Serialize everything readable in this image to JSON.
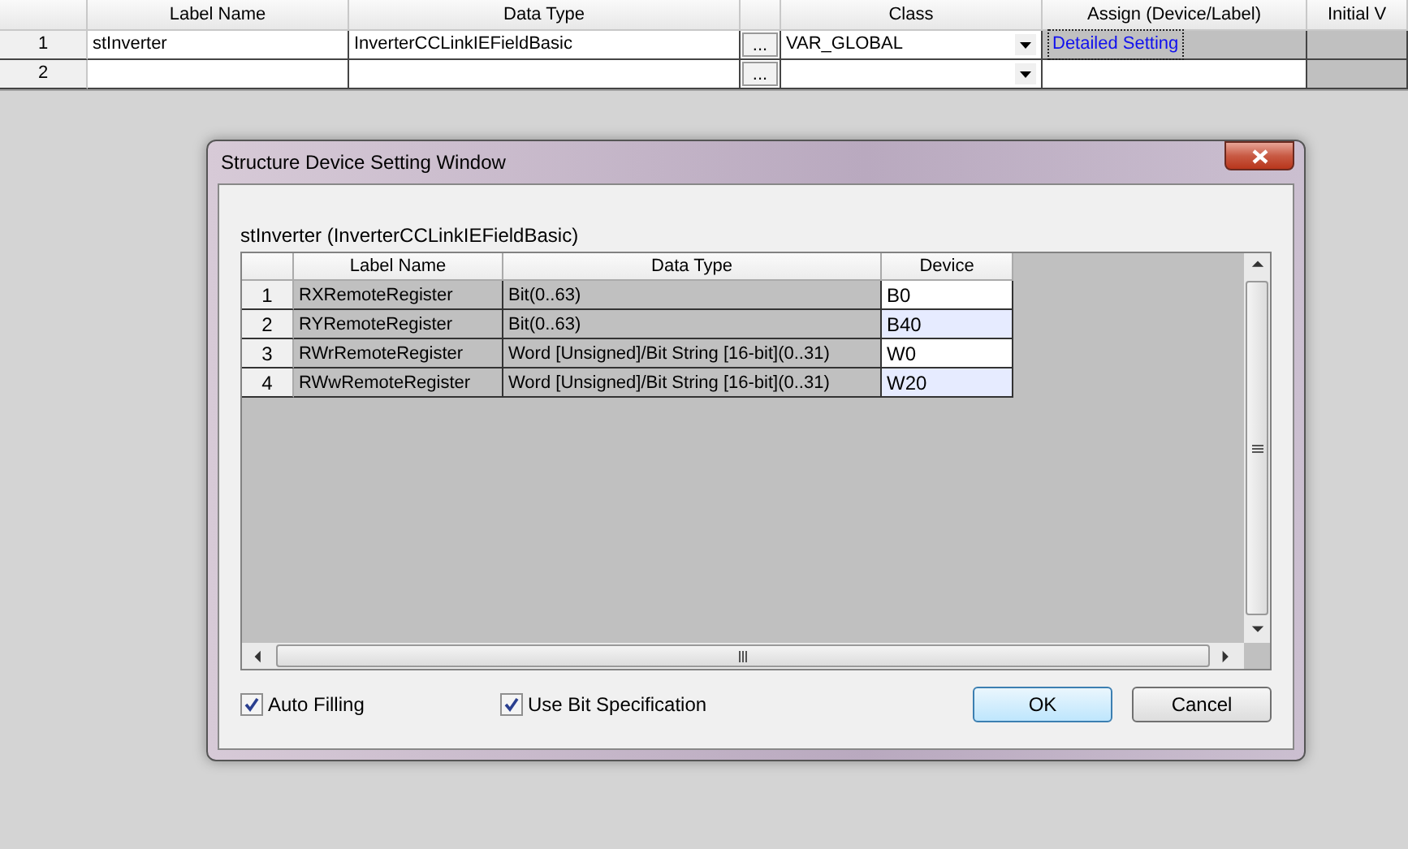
{
  "grid": {
    "columns": [
      "Label Name",
      "Data Type",
      "Class",
      "Assign (Device/Label)",
      "Initial V"
    ],
    "rows": [
      {
        "number": "1",
        "label_name": "stInverter",
        "data_type": "InverterCCLinkIEFieldBasic",
        "browse": "...",
        "class": "VAR_GLOBAL",
        "assign": "Detailed Setting"
      },
      {
        "number": "2",
        "browse": "..."
      }
    ]
  },
  "dialog": {
    "title": "Structure Device Setting Window",
    "heading": "stInverter (InverterCCLinkIEFieldBasic)",
    "columns": [
      "Label Name",
      "Data Type",
      "Device"
    ],
    "rows": [
      {
        "number": "1",
        "label_name": "RXRemoteRegister",
        "data_type": "Bit(0..63)",
        "device": "B0"
      },
      {
        "number": "2",
        "label_name": "RYRemoteRegister",
        "data_type": "Bit(0..63)",
        "device": "B40"
      },
      {
        "number": "3",
        "label_name": "RWrRemoteRegister",
        "data_type": "Word [Unsigned]/Bit String [16-bit](0..31)",
        "device": "W0"
      },
      {
        "number": "4",
        "label_name": "RWwRemoteRegister",
        "data_type": "Word [Unsigned]/Bit String [16-bit](0..31)",
        "device": "W20"
      }
    ],
    "options": [
      {
        "label": "Auto Filling",
        "checked": true
      },
      {
        "label": "Use Bit Specification",
        "checked": true
      }
    ],
    "buttons": [
      "OK",
      "Cancel"
    ]
  }
}
